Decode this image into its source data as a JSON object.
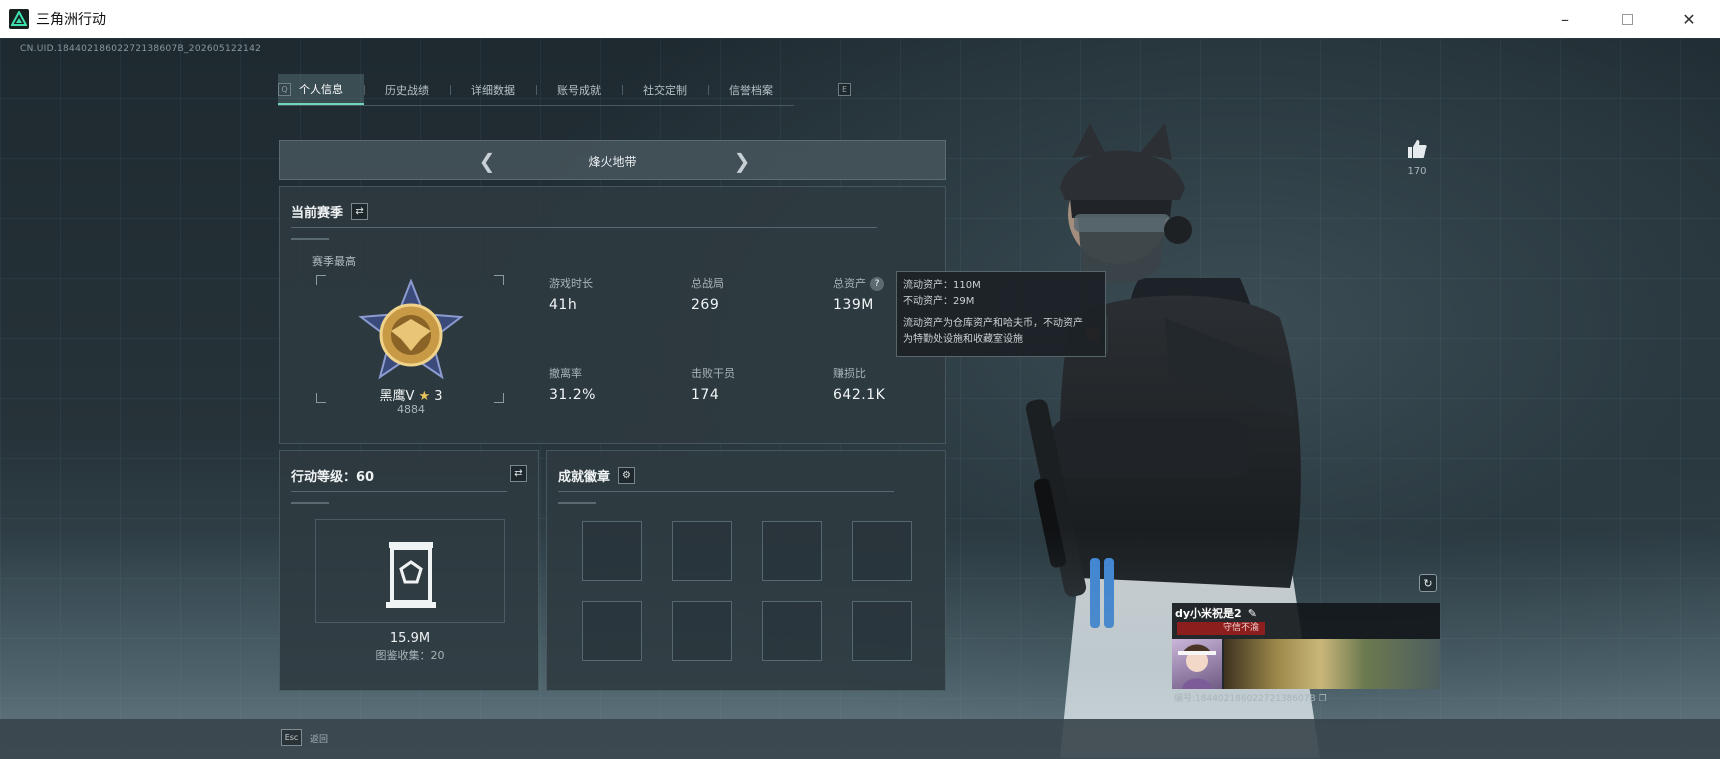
{
  "window": {
    "title": "三角洲行动"
  },
  "uid": "CN.UID.18440218602272138607B_202605122142",
  "tabs": [
    {
      "label": "个人信息",
      "active": true
    },
    {
      "label": "历史战绩",
      "active": false
    },
    {
      "label": "详细数据",
      "active": false
    },
    {
      "label": "账号成就",
      "active": false
    },
    {
      "label": "社交定制",
      "active": false
    },
    {
      "label": "信誉档案",
      "active": false
    }
  ],
  "keys": {
    "prev": "Q",
    "next": "E",
    "esc": "Esc",
    "esc_label": "返回"
  },
  "mode": {
    "label": "烽火地带"
  },
  "season": {
    "title": "当前赛季",
    "peak_label": "赛季最高",
    "rank_name": "黑鹰V",
    "rank_stars": "3",
    "rank_score": "4884",
    "stats": [
      {
        "label": "游戏时长",
        "value": "41h"
      },
      {
        "label": "总战局",
        "value": "269"
      },
      {
        "label": "总资产",
        "value": "139M"
      },
      {
        "label": "撤离率",
        "value": "31.2%"
      },
      {
        "label": "击败干员",
        "value": "174"
      },
      {
        "label": "赚损比",
        "value": "642.1K"
      }
    ]
  },
  "tooltip": {
    "liquid": "流动资产：110M",
    "fixed": "不动资产：29M",
    "desc_1": "流动资产为仓库资产和哈夫币，不动资产",
    "desc_2": "为特勤处设施和收藏室设施"
  },
  "level": {
    "title": "行动等级：60",
    "value": "15.9M",
    "collection": "图鉴收集：20"
  },
  "badges": {
    "title": "成就徽章",
    "slots": 8
  },
  "like": {
    "count": "170"
  },
  "card": {
    "name": "dy小米祝是2",
    "motto": "守信不渝",
    "id": "编号:18440218602272138607B"
  },
  "colors": {
    "accent": "#6fd6b7",
    "motto_bg": "#8c1e1e"
  }
}
